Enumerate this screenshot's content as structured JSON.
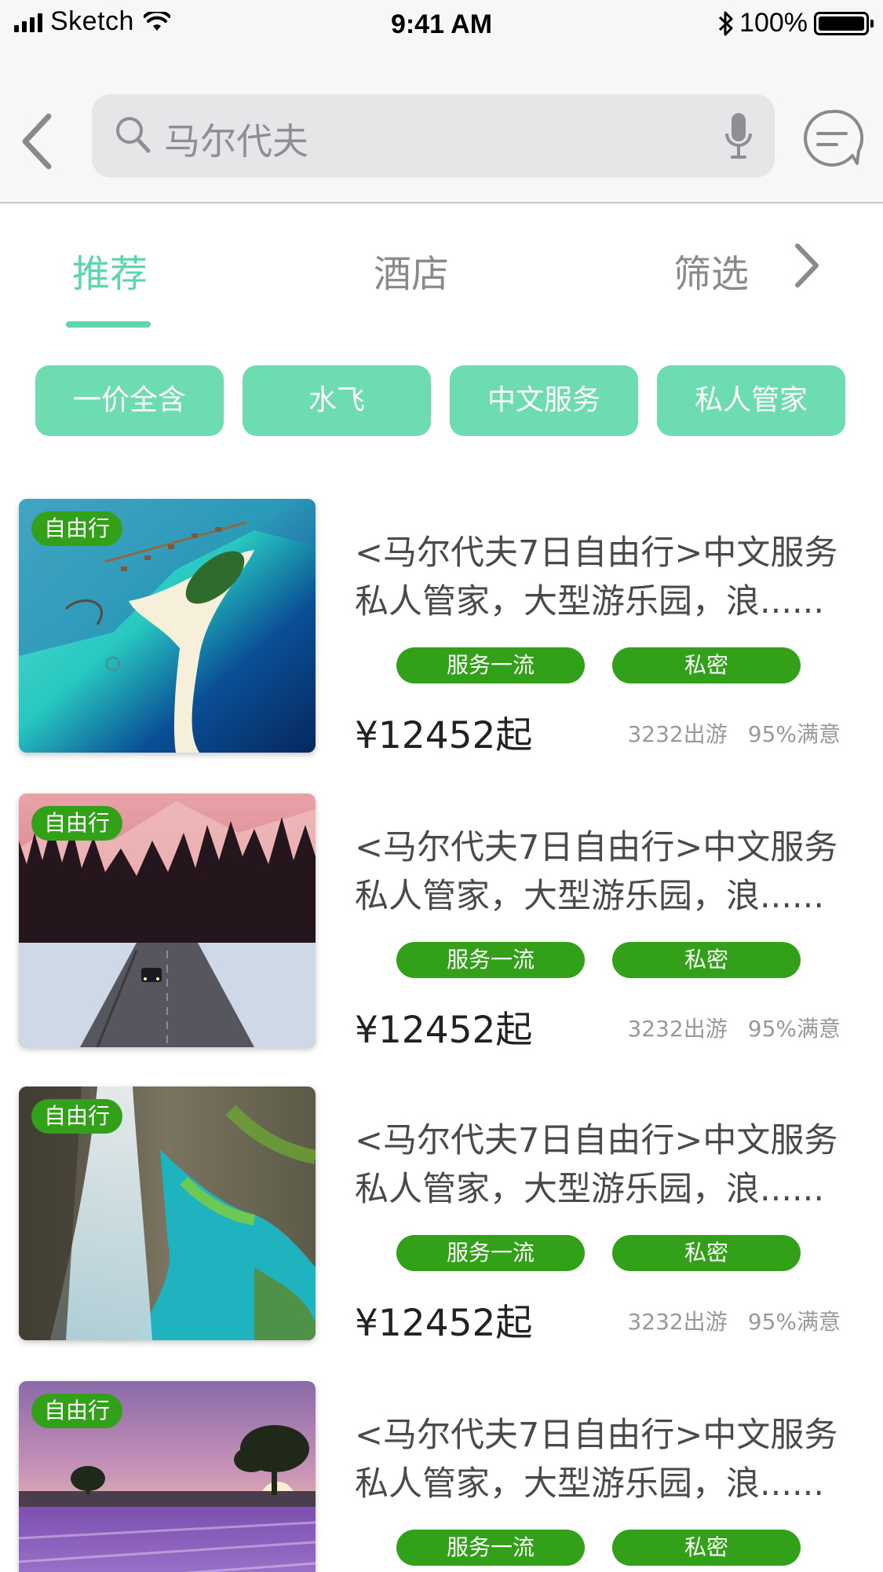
{
  "status_bar": {
    "carrier": "Sketch",
    "time": "9:41 AM",
    "battery": "100%"
  },
  "nav": {
    "search_placeholder": "马尔代夫"
  },
  "tabs": [
    {
      "label": "推荐",
      "active": true
    },
    {
      "label": "酒店",
      "active": false
    },
    {
      "label": "筛选",
      "active": false
    }
  ],
  "filters": [
    "一价全含",
    "水飞",
    "中文服务",
    "私人管家"
  ],
  "products": [
    {
      "badge": "自由行",
      "title_line1": "<马尔代夫7日自由行>中文服务",
      "title_line2": "私人管家，大型游乐园，浪......",
      "tags": [
        "服务一流",
        "私密"
      ],
      "price": "¥12452起",
      "trips": "3232出游",
      "satisfaction": "95%满意",
      "image": "tropical-island-aerial"
    },
    {
      "badge": "自由行",
      "title_line1": "<马尔代夫7日自由行>中文服务",
      "title_line2": "私人管家，大型游乐园，浪......",
      "tags": [
        "服务一流",
        "私密"
      ],
      "price": "¥12452起",
      "trips": "3232出游",
      "satisfaction": "95%满意",
      "image": "snowy-forest-road"
    },
    {
      "badge": "自由行",
      "title_line1": "<马尔代夫7日自由行>中文服务",
      "title_line2": "私人管家，大型游乐园，浪......",
      "tags": [
        "服务一流",
        "私密"
      ],
      "price": "¥12452起",
      "trips": "3232出游",
      "satisfaction": "95%满意",
      "image": "waterfall-canyon"
    },
    {
      "badge": "自由行",
      "title_line1": "<马尔代夫7日自由行>中文服务",
      "title_line2": "私人管家，大型游乐园，浪......",
      "tags": [
        "服务一流",
        "私密"
      ],
      "price": "",
      "trips": "",
      "satisfaction": "",
      "image": "lavender-field-sunset"
    }
  ],
  "colors": {
    "accent": "#5bd6b0",
    "chip": "#6edcb1",
    "tag_green": "#33a01a"
  }
}
